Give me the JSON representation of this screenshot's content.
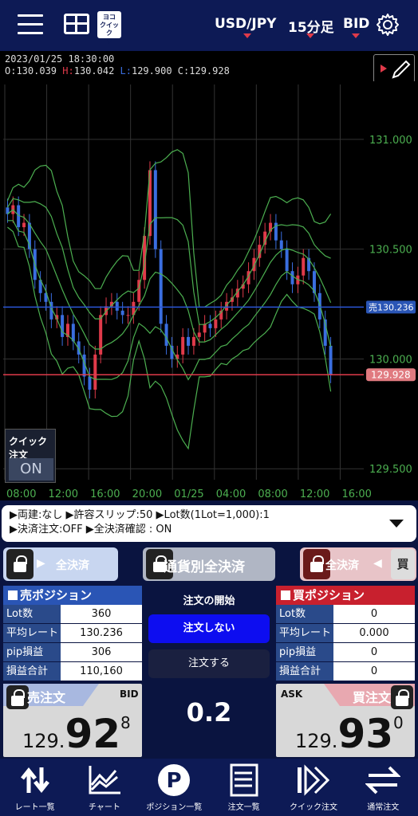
{
  "header": {
    "pair": "USD/JPY",
    "timeframe": "15分足",
    "price_type": "BID",
    "quick_icon_line1": "ヨコ",
    "quick_icon_line2": "クイック",
    "quick_icon_line3": "▼",
    "accent_color": "#e03a4a"
  },
  "chart_info": {
    "datetime": "2023/01/25  18:30:00",
    "open_label": "O:",
    "open": "130.039",
    "high_label": "H:",
    "high": "130.042",
    "low_label": "L:",
    "low": "129.900",
    "close_label": "C:",
    "close": "129.928"
  },
  "chart_data": {
    "type": "candlestick",
    "y_ticks": [
      "131.000",
      "130.500",
      "130.000",
      "129.500"
    ],
    "ylim": [
      129.45,
      131.25
    ],
    "x_ticks": [
      "08:00",
      "12:00",
      "16:00",
      "20:00",
      "01/25",
      "04:00",
      "08:00",
      "12:00",
      "16:00"
    ],
    "position_line_label": "売130.236",
    "position_line_value": 130.236,
    "current_price_label": "129.928",
    "current_price_value": 129.928,
    "indicator": "Bollinger Bands",
    "up_color": "#e03a4a",
    "down_color": "#3a6ee0",
    "band_color": "#4caf50",
    "close_series": [
      130.66,
      130.7,
      130.6,
      130.62,
      130.5,
      130.36,
      130.3,
      130.26,
      130.18,
      130.2,
      130.1,
      130.16,
      130.08,
      130.02,
      129.92,
      129.86,
      130.02,
      130.2,
      130.24,
      130.26,
      130.22,
      130.2,
      130.2,
      130.26,
      130.36,
      130.56,
      130.86,
      130.5,
      130.16,
      130.06,
      130.0,
      130.02,
      130.1,
      130.06,
      130.1,
      130.12,
      130.16,
      130.14,
      130.18,
      130.22,
      130.26,
      130.28,
      130.32,
      130.34,
      130.4,
      130.46,
      130.52,
      130.58,
      130.62,
      130.54,
      130.5,
      130.4,
      130.34,
      130.38,
      130.46,
      130.4,
      130.3,
      130.18,
      130.06,
      129.93
    ]
  },
  "quick_order": {
    "label": "クイック注文",
    "state": "ON"
  },
  "settings": {
    "line1": "▶両建:なし  ▶許容スリップ:50  ▶Lot数(1Lot=1,000):1",
    "line2": "▶決済注文:OFF  ▶全決済確認 : ON"
  },
  "buttons": {
    "settle_all_sell": "全決済",
    "settle_all_ccy": "通貨別全決済",
    "settle_all_buy": "全決済",
    "buy_side": "買"
  },
  "sell_position": {
    "title": "売ポジション",
    "rows": [
      {
        "k": "Lot数",
        "v": "360"
      },
      {
        "k": "平均レート",
        "v": "130.236"
      },
      {
        "k": "pip損益",
        "v": "306"
      },
      {
        "k": "損益合計",
        "v": "110,160"
      }
    ]
  },
  "buy_position": {
    "title": "買ポジション",
    "rows": [
      {
        "k": "Lot数",
        "v": "0"
      },
      {
        "k": "平均レート",
        "v": "0.000"
      },
      {
        "k": "pip損益",
        "v": "0"
      },
      {
        "k": "損益合計",
        "v": "0"
      }
    ]
  },
  "order_start": {
    "title": "注文の開始",
    "no_order": "注文しない",
    "do_order": "注文する",
    "lot": "0.2"
  },
  "sell_order": {
    "label": "売注文",
    "type": "BID",
    "price_small": "129.",
    "price_big": "92",
    "price_sup": "8"
  },
  "buy_order": {
    "label": "買注文",
    "type": "ASK",
    "price_small": "129.",
    "price_big": "93",
    "price_sup": "0"
  },
  "nav": [
    {
      "label": "レート一覧",
      "icon": "rate-list-icon"
    },
    {
      "label": "チャート",
      "icon": "chart-icon"
    },
    {
      "label": "ポジション一覧",
      "icon": "position-icon"
    },
    {
      "label": "注文一覧",
      "icon": "order-list-icon"
    },
    {
      "label": "クイック注文",
      "icon": "quick-order-icon"
    },
    {
      "label": "通常注文",
      "icon": "normal-order-icon"
    }
  ]
}
